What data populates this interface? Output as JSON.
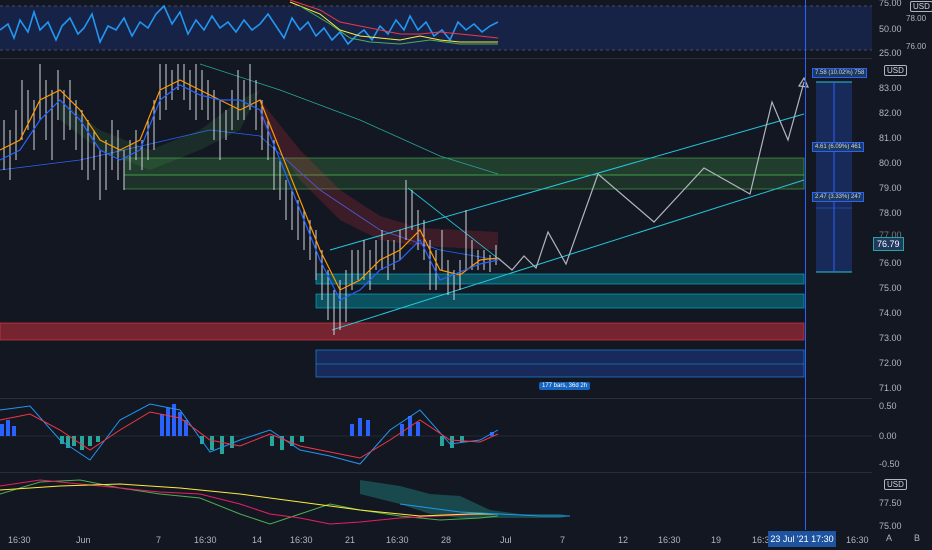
{
  "axes": {
    "currency": "USD",
    "rsi_ticks": [
      "75.00",
      "50.00",
      "25.00"
    ],
    "rsi_badges": [
      "78.00",
      "76.00"
    ],
    "price_ticks": [
      "83.00",
      "82.00",
      "81.00",
      "80.00",
      "79.00",
      "78.00",
      "77.00",
      "76.00",
      "75.00",
      "74.00",
      "73.00",
      "72.00",
      "71.00"
    ],
    "macd_ticks": [
      "0.50",
      "0.00",
      "-0.50"
    ],
    "ichimoku_ticks": [
      "77.50",
      "75.00"
    ],
    "current_price": "76.79"
  },
  "time_axis": [
    "16:30",
    "Jun",
    "7",
    "16:30",
    "14",
    "16:30",
    "21",
    "16:30",
    "28",
    "Jul",
    "7",
    "12",
    "16:30",
    "19",
    "16:30",
    "16:30"
  ],
  "crosshair_time": "23 Jul '21   17:30",
  "projection_labels": {
    "top": "7.58 (10.02%) 758",
    "middle": "4.61 (6.09%) 461",
    "bottom": "2.47 (3.33%) 247"
  },
  "bars_range_label": "177 bars, 36d 2h",
  "buttons": {
    "auto": "A",
    "log": "B"
  },
  "colors": {
    "background": "#131722",
    "rsi_line": "#2196f3",
    "fast_ma": "#ff9800",
    "slow_ma": "#2962ff",
    "green_zone": "#4caf50",
    "teal_zone": "#00bcd4",
    "red_zone": "#f23645",
    "crosshair": "#2962ff"
  }
}
